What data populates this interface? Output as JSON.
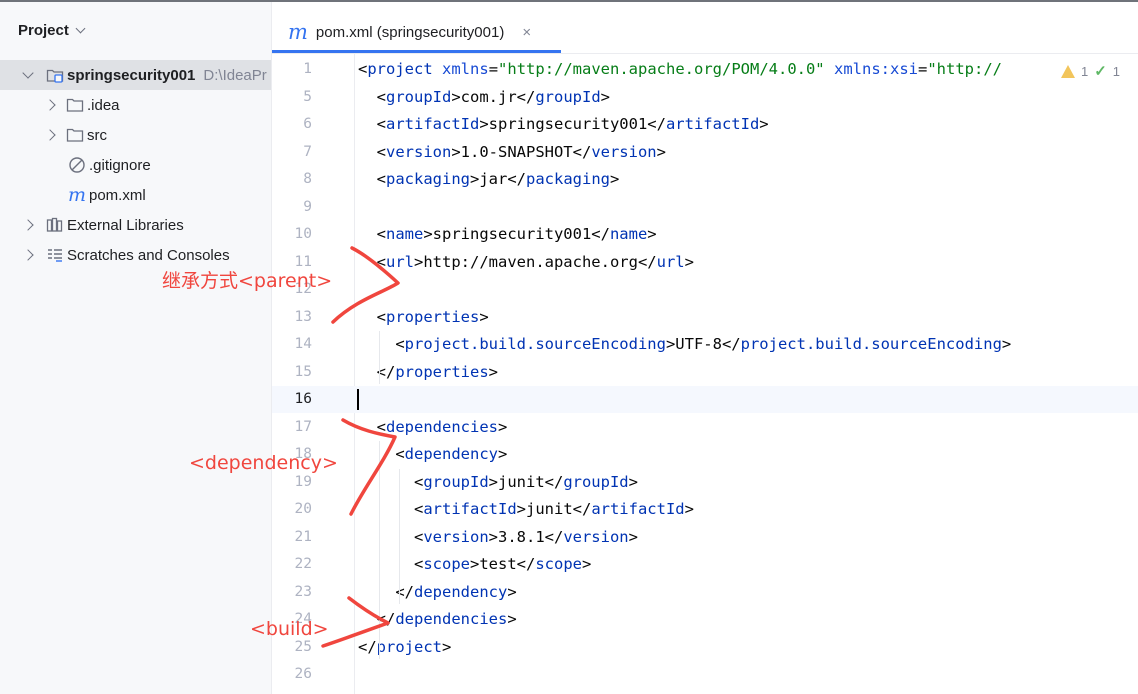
{
  "project_panel": {
    "title": "Project",
    "items": [
      {
        "label": "springsecurity001",
        "hint": "D:\\IdeaPr",
        "icon": "module-folder-icon",
        "expanded": true
      },
      {
        "label": ".idea",
        "icon": "folder-icon"
      },
      {
        "label": "src",
        "icon": "folder-icon"
      },
      {
        "label": ".gitignore",
        "icon": "ignored-file-icon"
      },
      {
        "label": "pom.xml",
        "icon": "maven-icon"
      },
      {
        "label": "External Libraries",
        "icon": "library-icon"
      },
      {
        "label": "Scratches and Consoles",
        "icon": "scratches-icon"
      }
    ]
  },
  "editor": {
    "tab_title": "pom.xml (springsecurity001)",
    "tab_icon": "m",
    "close_glyph": "×",
    "inspections": {
      "warnings": "1",
      "ok": "1"
    },
    "lines": [
      {
        "n": "1",
        "text": "<project xmlns=\"http://maven.apache.org/POM/4.0.0\" xmlns:xsi=\"http://"
      },
      {
        "n": "5",
        "text": "  <groupId>com.jr</groupId>"
      },
      {
        "n": "6",
        "text": "  <artifactId>springsecurity001</artifactId>"
      },
      {
        "n": "7",
        "text": "  <version>1.0-SNAPSHOT</version>"
      },
      {
        "n": "8",
        "text": "  <packaging>jar</packaging>"
      },
      {
        "n": "9",
        "text": ""
      },
      {
        "n": "10",
        "text": "  <name>springsecurity001</name>"
      },
      {
        "n": "11",
        "text": "  <url>http://maven.apache.org</url>"
      },
      {
        "n": "12",
        "text": ""
      },
      {
        "n": "13",
        "text": "  <properties>"
      },
      {
        "n": "14",
        "text": "    <project.build.sourceEncoding>UTF-8</project.build.sourceEncoding>"
      },
      {
        "n": "15",
        "text": "  </properties>"
      },
      {
        "n": "16",
        "text": "",
        "current": true
      },
      {
        "n": "17",
        "text": "  <dependencies>"
      },
      {
        "n": "18",
        "text": "    <dependency>"
      },
      {
        "n": "19",
        "text": "      <groupId>junit</groupId>"
      },
      {
        "n": "20",
        "text": "      <artifactId>junit</artifactId>"
      },
      {
        "n": "21",
        "text": "      <version>3.8.1</version>"
      },
      {
        "n": "22",
        "text": "      <scope>test</scope>"
      },
      {
        "n": "23",
        "text": "    </dependency>"
      },
      {
        "n": "24",
        "text": "  </dependencies>"
      },
      {
        "n": "25",
        "text": "</project>"
      },
      {
        "n": "26",
        "text": ""
      }
    ]
  },
  "annotations": {
    "parent": "继承方式<parent>",
    "dependency": "<dependency>",
    "build": "<build>",
    "color": "#f0463e"
  }
}
